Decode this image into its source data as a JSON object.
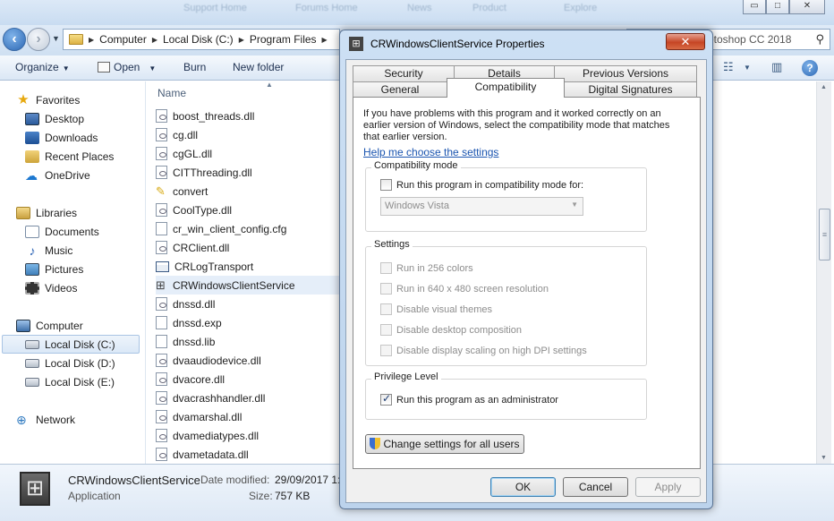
{
  "explorer": {
    "background_tabs": [
      "Support Home",
      "Forums Home",
      "News",
      "Product",
      "Explore"
    ],
    "window_controls": {
      "minimize": "▭",
      "maximize": "□",
      "close": "✕"
    },
    "address": {
      "segments": [
        "Computer",
        "Local Disk (C:)",
        "Program Files"
      ],
      "search_text": "otoshop CC 2018"
    },
    "toolbar": {
      "organize": "Organize",
      "open": "Open",
      "burn": "Burn",
      "new_folder": "New folder"
    },
    "nav": {
      "favorites": "Favorites",
      "favorites_items": [
        "Desktop",
        "Downloads",
        "Recent Places",
        "OneDrive"
      ],
      "libraries": "Libraries",
      "library_items": [
        "Documents",
        "Music",
        "Pictures",
        "Videos"
      ],
      "computer": "Computer",
      "drives": [
        "Local Disk (C:)",
        "Local Disk (D:)",
        "Local Disk (E:)"
      ],
      "network": "Network"
    },
    "files": {
      "column_name": "Name",
      "items": [
        {
          "name": "boost_threads.dll",
          "icon": "dll-icon"
        },
        {
          "name": "cg.dll",
          "icon": "dll-icon"
        },
        {
          "name": "cgGL.dll",
          "icon": "dll-icon"
        },
        {
          "name": "CITThreading.dll",
          "icon": "dll-icon"
        },
        {
          "name": "convert",
          "icon": "wand-icon"
        },
        {
          "name": "CoolType.dll",
          "icon": "dll-icon"
        },
        {
          "name": "cr_win_client_config.cfg",
          "icon": "file-icon"
        },
        {
          "name": "CRClient.dll",
          "icon": "dll-icon"
        },
        {
          "name": "CRLogTransport",
          "icon": "exe-icon"
        },
        {
          "name": "CRWindowsClientService",
          "icon": "service-icon"
        },
        {
          "name": "dnssd.dll",
          "icon": "dll-icon"
        },
        {
          "name": "dnssd.exp",
          "icon": "file-icon"
        },
        {
          "name": "dnssd.lib",
          "icon": "file-icon"
        },
        {
          "name": "dvaaudiodevice.dll",
          "icon": "dll-icon"
        },
        {
          "name": "dvacore.dll",
          "icon": "dll-icon"
        },
        {
          "name": "dvacrashhandler.dll",
          "icon": "dll-icon"
        },
        {
          "name": "dvamarshal.dll",
          "icon": "dll-icon"
        },
        {
          "name": "dvamediatypes.dll",
          "icon": "dll-icon"
        },
        {
          "name": "dvametadata.dll",
          "icon": "dll-icon"
        }
      ]
    },
    "details": {
      "name": "CRWindowsClientService",
      "type": "Application",
      "date_label": "Date modified:",
      "date_value": "29/09/2017 1:",
      "size_label": "Size:",
      "size_value": "757 KB"
    }
  },
  "dialog": {
    "title": "CRWindowsClientService Properties",
    "close": "✕",
    "tabs_row1": [
      "Security",
      "Details",
      "Previous Versions"
    ],
    "tabs_row2": [
      "General",
      "Compatibility",
      "Digital Signatures"
    ],
    "intro": "If you have problems with this program and it worked correctly on an earlier version of Windows, select the compatibility mode that matches that earlier version.",
    "help_link": "Help me choose the settings",
    "compat_group": "Compatibility mode",
    "compat_checkbox": "Run this program in compatibility mode for:",
    "compat_select": "Windows Vista",
    "settings_group": "Settings",
    "settings": [
      "Run in 256 colors",
      "Run in 640 x 480 screen resolution",
      "Disable visual themes",
      "Disable desktop composition",
      "Disable display scaling on high DPI settings"
    ],
    "privilege_group": "Privilege Level",
    "admin_checkbox": "Run this program as an administrator",
    "change_all": "Change settings for all users",
    "ok": "OK",
    "cancel": "Cancel",
    "apply": "Apply"
  },
  "colors": {
    "accent": "#2d68b4",
    "link": "#1b55b0",
    "close_red": "#c64524"
  }
}
